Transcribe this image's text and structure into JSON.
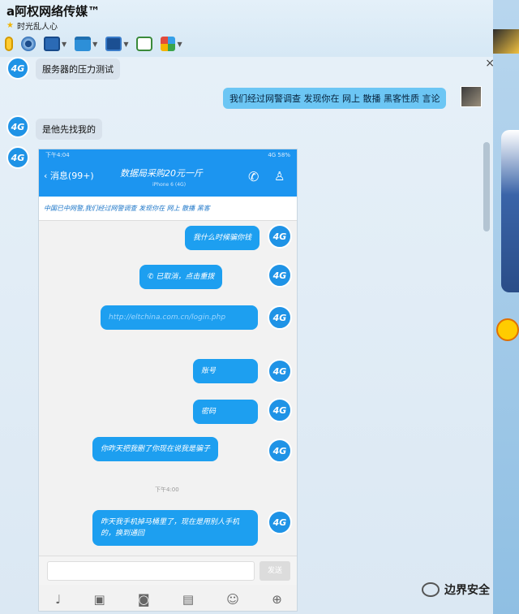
{
  "window": {
    "title": "a阿权网络传媒™",
    "subtitle": "时光乱人心"
  },
  "toolbar": {
    "icons": [
      "microphone-icon",
      "camera-icon",
      "screen-share-icon",
      "file-transfer-icon",
      "remote-desktop-icon",
      "new-chat-icon",
      "apps-icon"
    ]
  },
  "chat": {
    "messages": [
      {
        "side": "in",
        "text": "服务器的压力测试"
      },
      {
        "side": "out",
        "text": "我们经过网警调查 发现你在 网上 散播 黑客性质 言论"
      },
      {
        "side": "in",
        "text": "是他先找我的"
      }
    ],
    "avatar_label": "4G"
  },
  "phone": {
    "status_left": "下午4:04",
    "status_right": "4G 58%",
    "back_label": "消息(99+)",
    "contact_title": "数据局采购20元一斤",
    "contact_sub": "iPhone 6 (4G)",
    "banner": "中国已中网警,我们经过网警调查 发现你在 网上 散播 黑客",
    "bubbles": [
      "我什么时候骗你钱",
      "已取消，点击重拨",
      "http://eltchina.com.cn/login.php",
      "账号",
      "密码",
      "你昨天把我删了你现在说我是骗子",
      "昨天我手机掉马桶里了，现在是用别人手机的，换到通回"
    ],
    "timestamp": "下午4:00",
    "send_label": "发送"
  },
  "watermark": "边界安全"
}
